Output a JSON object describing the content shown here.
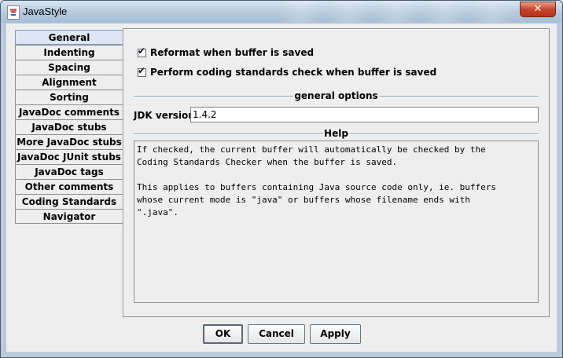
{
  "window": {
    "title": "JavaStyle",
    "close_label": "✕"
  },
  "sidebar": {
    "tabs": [
      {
        "label": "General",
        "active": true
      },
      {
        "label": "Indenting",
        "active": false
      },
      {
        "label": "Spacing",
        "active": false
      },
      {
        "label": "Alignment",
        "active": false
      },
      {
        "label": "Sorting",
        "active": false
      },
      {
        "label": "JavaDoc comments",
        "active": false
      },
      {
        "label": "JavaDoc stubs",
        "active": false
      },
      {
        "label": "More JavaDoc stubs",
        "active": false
      },
      {
        "label": "JavaDoc JUnit stubs",
        "active": false
      },
      {
        "label": "JavaDoc tags",
        "active": false
      },
      {
        "label": "Other comments",
        "active": false
      },
      {
        "label": "Coding Standards",
        "active": false
      },
      {
        "label": "Navigator",
        "active": false
      }
    ]
  },
  "general": {
    "reformat_label": "Reformat when buffer is saved",
    "reformat_checked": true,
    "check_label": "Perform coding standards check when buffer is saved",
    "check_checked": true,
    "options_title": "general options",
    "jdk_label": "JDK version:",
    "jdk_value": "1.4.2",
    "help_title": "Help",
    "help_text": "If checked, the current buffer will automatically be checked by the\nCoding Standards Checker when the buffer is saved.\n\nThis applies to buffers containing Java source code only, ie. buffers\nwhose current mode is \"java\" or buffers whose filename ends with\n\".java\"."
  },
  "footer": {
    "ok_label": "OK",
    "cancel_label": "Cancel",
    "apply_label": "Apply"
  }
}
